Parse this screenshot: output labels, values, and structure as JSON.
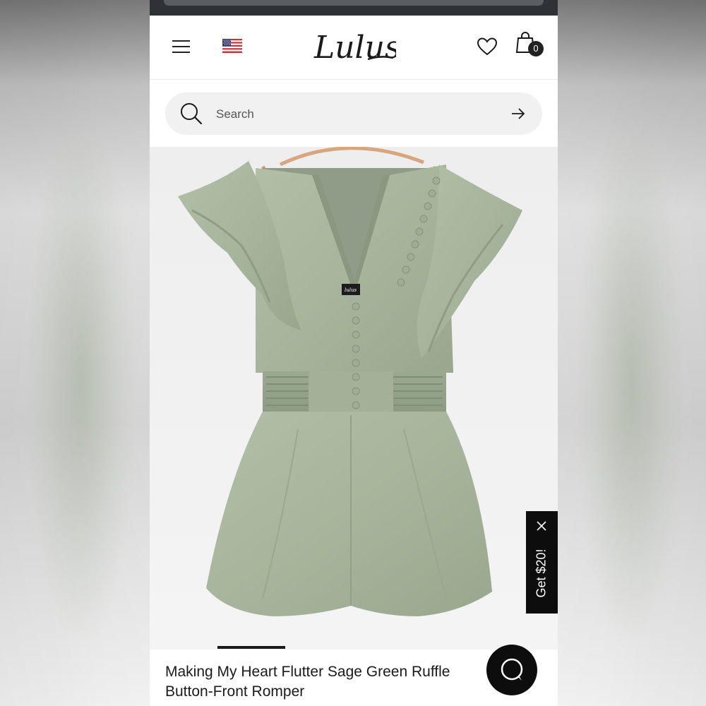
{
  "header": {
    "logo_text": "Lulus",
    "cart_count": "0"
  },
  "search": {
    "placeholder": "Search"
  },
  "product": {
    "title_line1": "Making My Heart Flutter Sage Green Ruffle",
    "title_line2": "Button-Front Romper",
    "label_text": "lulus",
    "color": "#a7b59c"
  },
  "promo": {
    "label": "Get $20!"
  },
  "carousel": {
    "active_index": 1
  },
  "colors": {
    "header_bg": "#ffffff",
    "search_bg": "#f1f1f1",
    "accent_dark": "#0d0d0d",
    "dress_sage": "#a7b59c"
  }
}
